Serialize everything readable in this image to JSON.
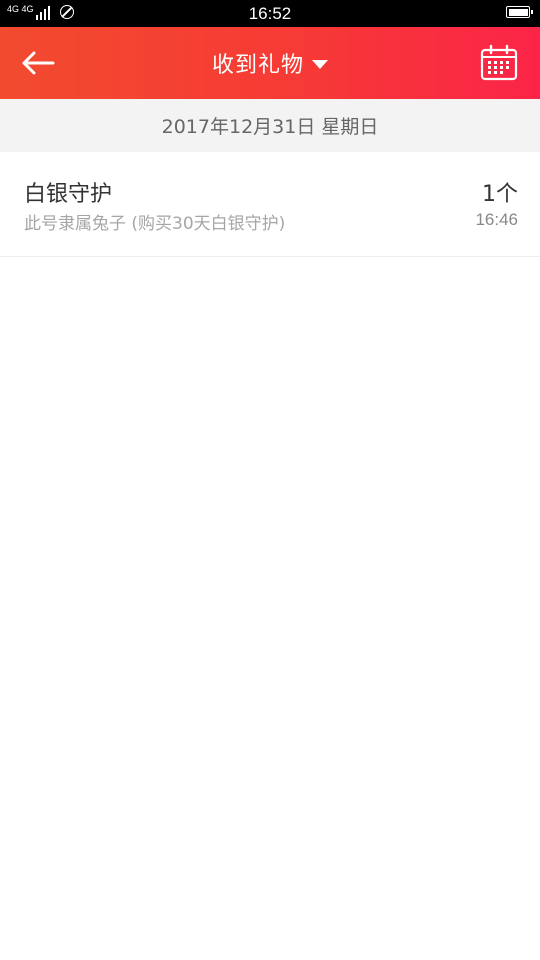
{
  "status_bar": {
    "network": "4G 4G",
    "time": "16:52"
  },
  "header": {
    "title": "收到礼物",
    "back_icon": "arrow-left",
    "calendar_icon": "calendar",
    "header_gradient": [
      "#f24b2f",
      "#fb2448"
    ]
  },
  "date_bar": {
    "date": "2017年12月31日 星期日"
  },
  "gifts": [
    {
      "name": "白银守护",
      "description": "此号隶属兔子 (购买30天白银守护)",
      "count": "1个",
      "time": "16:46"
    }
  ]
}
